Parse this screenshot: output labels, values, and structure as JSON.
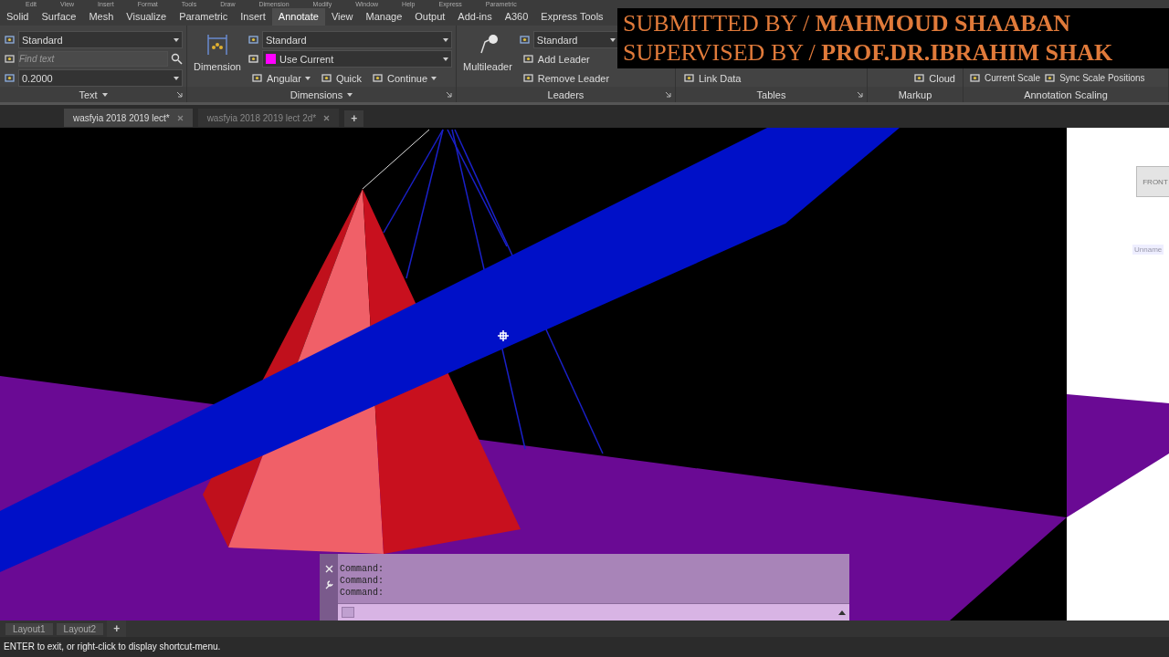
{
  "menu_bar": [
    "Edit",
    "View",
    "Insert",
    "Format",
    "Tools",
    "Draw",
    "Dimension",
    "Modify",
    "Window",
    "Help",
    "Express",
    "Parametric"
  ],
  "ribbon_tabs": [
    {
      "label": "Solid",
      "selected": false
    },
    {
      "label": "Surface",
      "selected": false
    },
    {
      "label": "Mesh",
      "selected": false
    },
    {
      "label": "Visualize",
      "selected": false
    },
    {
      "label": "Parametric",
      "selected": false
    },
    {
      "label": "Insert",
      "selected": false
    },
    {
      "label": "Annotate",
      "selected": true
    },
    {
      "label": "View",
      "selected": false
    },
    {
      "label": "Manage",
      "selected": false
    },
    {
      "label": "Output",
      "selected": false
    },
    {
      "label": "Add-ins",
      "selected": false
    },
    {
      "label": "A360",
      "selected": false
    },
    {
      "label": "Express Tools",
      "selected": false
    }
  ],
  "panels": [
    {
      "title": "Text",
      "title_caret": true,
      "launcher": true,
      "rows": [
        [
          {
            "kind": "dropdown",
            "value": "Standard"
          }
        ],
        [
          {
            "kind": "field",
            "placeholder": "Find text"
          }
        ],
        [
          {
            "kind": "dropdown",
            "value": "0.2000"
          }
        ]
      ]
    },
    {
      "title": "Dimensions",
      "title_caret": true,
      "launcher": true,
      "large": "Dimension",
      "rows": [
        [
          {
            "kind": "dropdown",
            "value": "Standard"
          }
        ],
        [
          {
            "kind": "swatch",
            "value": "Use Current",
            "color": "#ff00ff"
          }
        ],
        [
          {
            "kind": "button",
            "label": "Angular",
            "caret": true
          },
          {
            "kind": "button",
            "label": "Quick",
            "caret": false
          },
          {
            "kind": "button",
            "label": "Continue",
            "caret": true
          }
        ]
      ]
    },
    {
      "title": "Leaders",
      "title_caret": false,
      "launcher": true,
      "large": "Multileader",
      "rows": [
        [
          {
            "kind": "dropdown",
            "value": "Standard"
          }
        ],
        [
          {
            "kind": "button",
            "label": "Add Leader",
            "caret": false
          }
        ],
        [
          {
            "kind": "button",
            "label": "Remove Leader",
            "caret": false
          }
        ]
      ]
    },
    {
      "title": "Tables",
      "title_caret": false,
      "launcher": true,
      "rows": [
        [
          {
            "kind": "button",
            "label": "Link Data",
            "caret": false
          }
        ]
      ]
    },
    {
      "title": "Markup",
      "title_caret": false,
      "launcher": false,
      "rows": [
        [
          {
            "kind": "button",
            "label": "Cloud",
            "caret": false
          }
        ]
      ]
    },
    {
      "title": "Annotation Scaling",
      "title_caret": false,
      "launcher": false,
      "rows": [
        [
          {
            "kind": "button",
            "label": "Current Scale",
            "caret": false
          },
          {
            "kind": "button",
            "label": "Sync Scale Positions",
            "caret": false
          }
        ]
      ]
    }
  ],
  "banner": [
    "SUBMITTED BY / **MAHMOUD SHAABAN**",
    "SUPERVISED BY / **PROF.DR.IBRAHIM SHAK**"
  ],
  "file_tabs": [
    {
      "label": "wasfyia 2018 2019 lect*",
      "selected": true
    },
    {
      "label": "wasfyia 2018 2019 lect 2d*",
      "selected": false
    }
  ],
  "new_tab": "+",
  "viewcube": {
    "face": "FRONT",
    "view_name": "Unname"
  },
  "command_line": {
    "history": [
      "Command:",
      "Command:",
      "Command:"
    ]
  },
  "layout_tabs": [
    {
      "label": "Layout1",
      "selected": false
    },
    {
      "label": "Layout2",
      "selected": false
    }
  ],
  "new_layout": "+",
  "status_prompt": "ENTER to exit, or right-click to display shortcut-menu."
}
